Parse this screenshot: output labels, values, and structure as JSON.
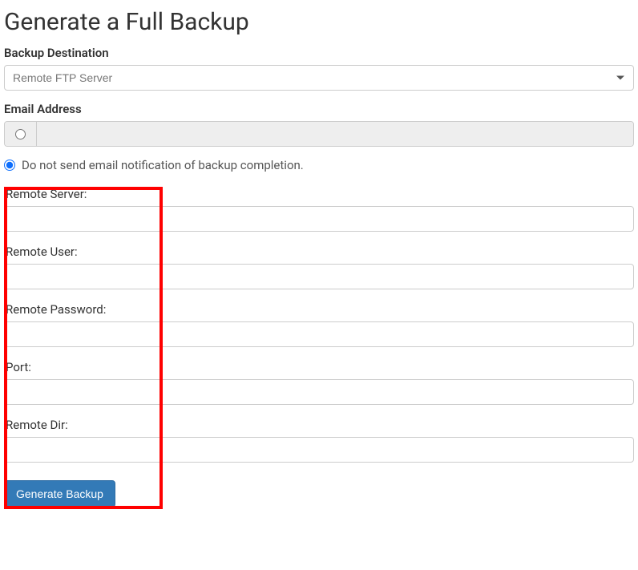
{
  "page": {
    "title": "Generate a Full Backup"
  },
  "form": {
    "destination_label": "Backup Destination",
    "destination_value": "Remote FTP Server",
    "email_label": "Email Address",
    "email_value": "",
    "no_email_label": "Do not send email notification of backup completion.",
    "fields": {
      "remote_server": {
        "label": "Remote Server:",
        "value": ""
      },
      "remote_user": {
        "label": "Remote User:",
        "value": ""
      },
      "remote_password": {
        "label": "Remote Password:",
        "value": ""
      },
      "port": {
        "label": "Port:",
        "value": ""
      },
      "remote_dir": {
        "label": "Remote Dir:",
        "value": ""
      }
    },
    "submit_label": "Generate Backup"
  }
}
